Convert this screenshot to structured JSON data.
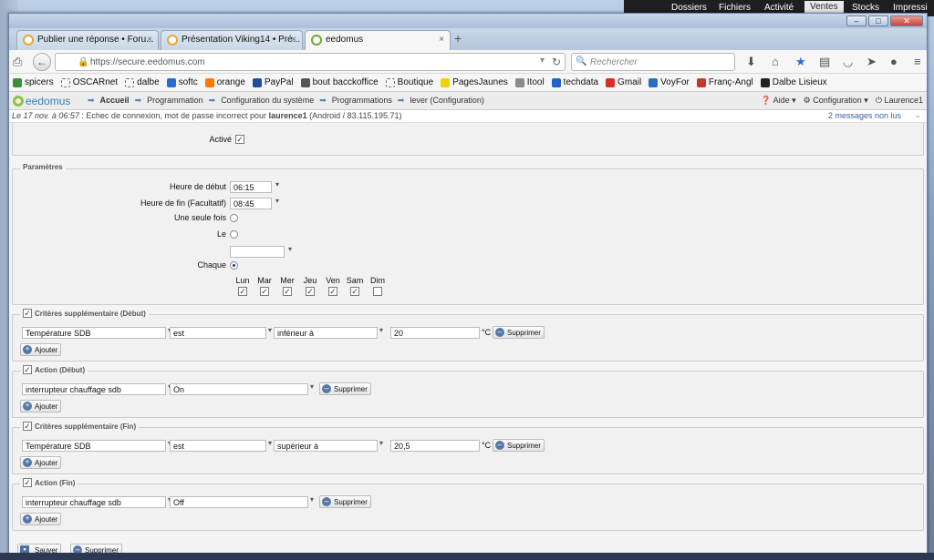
{
  "desktop": {
    "right_app": {
      "menu": [
        "Dossiers",
        "Fichiers",
        "Activité",
        "Ventes",
        "Stocks",
        "Impressi"
      ],
      "active": "Ventes"
    }
  },
  "browser": {
    "tabs": [
      {
        "label": "Publier une réponse • Foru...",
        "close": "×"
      },
      {
        "label": "Présentation Viking14 • Pré...",
        "close": "×"
      },
      {
        "label": "eedomus",
        "close": "×"
      }
    ],
    "new_tab": "+",
    "url": "https://secure.eedomus.com",
    "search_placeholder": "Rechercher",
    "window_controls": [
      "–",
      "□",
      "✕"
    ],
    "bookmarks": [
      {
        "label": "spicers",
        "color": "#3b8f3b"
      },
      {
        "label": "OSCARnet",
        "color": "#dddddd"
      },
      {
        "label": "dalbe",
        "color": "#dddddd"
      },
      {
        "label": "softc",
        "color": "#2a6bd1"
      },
      {
        "label": "orange",
        "color": "#ff7900"
      },
      {
        "label": "PayPal",
        "color": "#1e4e9c"
      },
      {
        "label": "bout bacckoffice",
        "color": "#555555"
      },
      {
        "label": "Boutique",
        "color": "#dddddd"
      },
      {
        "label": "PagesJaunes",
        "color": "#f2d100"
      },
      {
        "label": "Itool",
        "color": "#8a8a8a"
      },
      {
        "label": "techdata",
        "color": "#1f64c8"
      },
      {
        "label": "Gmail",
        "color": "#d93025"
      },
      {
        "label": "VoyFor",
        "color": "#2c6fbf"
      },
      {
        "label": "Franç-Angl",
        "color": "#c0392b"
      },
      {
        "label": "Dalbe Lisieux",
        "color": "#222222"
      }
    ]
  },
  "eedomus": {
    "logo": "eedomus",
    "breadcrumb": [
      "Accueil",
      "Programmation",
      "Configuration du système",
      "Programmations",
      "lever (Configuration)"
    ],
    "help": "Aide",
    "config": "Configuration",
    "user": "Laurence1",
    "status_prefix": "Le 17 nov. à 06:57",
    "status_text": ": Echec de connexion, mot de passe incorrect pour",
    "status_user": "laurence1",
    "status_suffix": "(Android / 83.115.195.71)",
    "messages": "2 messages non lus"
  },
  "form": {
    "active_label": "Activé",
    "params_legend": "Paramètres",
    "start_label": "Heure de début",
    "start_value": "06:15",
    "end_label": "Heure de fin (Facultatif)",
    "end_value": "08:45",
    "once_label": "Une seule fois",
    "on_label": "Le",
    "each_label": "Chaque",
    "days": [
      "Lun",
      "Mar",
      "Mer",
      "Jeu",
      "Ven",
      "Sam",
      "Dim"
    ],
    "days_checked": [
      true,
      true,
      true,
      true,
      true,
      true,
      false
    ],
    "crit_start": {
      "legend": "Critères supplémentaire (Début)",
      "device": "Température SDB",
      "op": "est",
      "cmp": "inférieur à",
      "value": "20",
      "unit": "°C"
    },
    "action_start": {
      "legend": "Action (Début)",
      "device": "interrupteur chauffage sdb",
      "value": "On"
    },
    "crit_end": {
      "legend": "Critères supplémentaire (Fin)",
      "device": "Température SDB",
      "op": "est",
      "cmp": "supérieur à",
      "value": "20,5",
      "unit": "°C"
    },
    "action_end": {
      "legend": "Action (Fin)",
      "device": "interrupteur chauffage sdb",
      "value": "Off"
    },
    "delete_label": "Supprimer",
    "add_label": "Ajouter",
    "save_label": "Sauver",
    "delete_all_label": "Supprimer"
  }
}
